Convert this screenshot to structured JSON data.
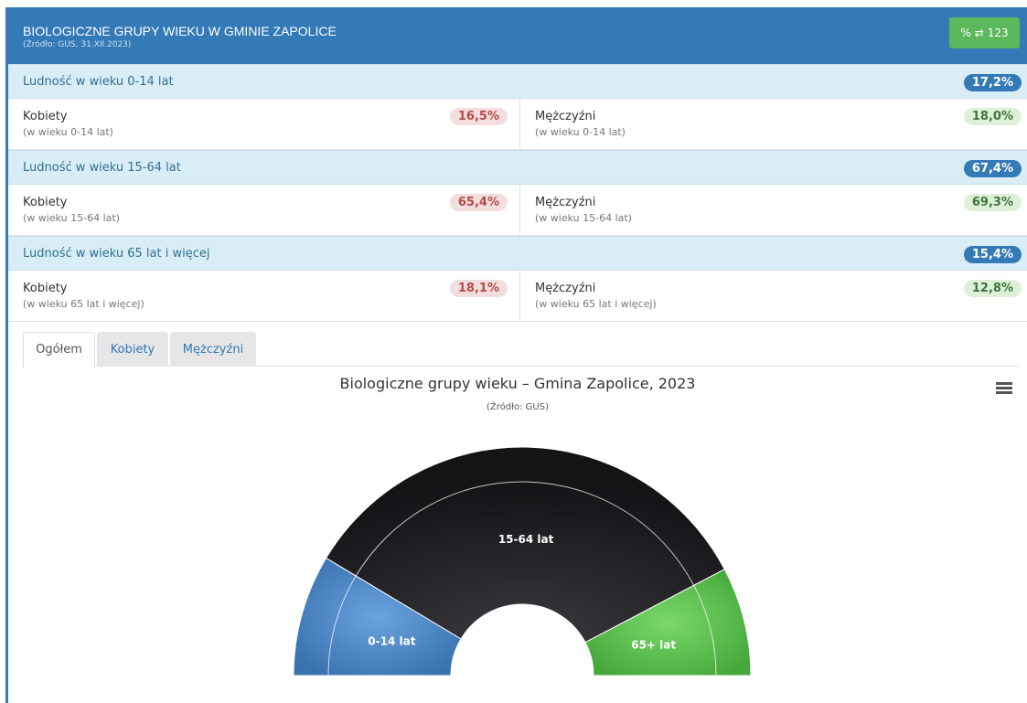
{
  "header": {
    "title": "BIOLOGICZNE GRUPY WIEKU W GMINIE ZAPOLICE",
    "subtitle": "(Źródło: GUS, 31.XII.2023)",
    "toggle_percent": "%",
    "toggle_value": "123"
  },
  "groups": [
    {
      "label": "Ludność w wieku 0-14 lat",
      "total": "17,2%",
      "women_label": "Kobiety",
      "women_note": "(w wieku 0-14 lat)",
      "women_value": "16,5%",
      "men_label": "Mężczyźni",
      "men_note": "(w wieku 0-14 lat)",
      "men_value": "18,0%"
    },
    {
      "label": "Ludność w wieku 15-64 lat",
      "total": "67,4%",
      "women_label": "Kobiety",
      "women_note": "(w wieku 15-64 lat)",
      "women_value": "65,4%",
      "men_label": "Mężczyźni",
      "men_note": "(w wieku 15-64 lat)",
      "men_value": "69,3%"
    },
    {
      "label": "Ludność w wieku 65 lat i więcej",
      "total": "15,4%",
      "women_label": "Kobiety",
      "women_note": "(w wieku 65 lat i więcej)",
      "women_value": "18,1%",
      "men_label": "Mężczyźni",
      "men_note": "(w wieku 65 lat i więcej)",
      "men_value": "12,8%"
    }
  ],
  "tabs": [
    {
      "label": "Ogółem",
      "active": true
    },
    {
      "label": "Kobiety",
      "active": false
    },
    {
      "label": "Mężczyźni",
      "active": false
    }
  ],
  "chart_data": {
    "type": "pie",
    "variant": "semi-donut",
    "title": "Biologiczne grupy wieku – Gmina Zapolice, 2023",
    "subtitle": "(Źródło: GUS)",
    "categories": [
      "0-14 lat",
      "15-64 lat",
      "65+ lat"
    ],
    "values": [
      17.2,
      67.4,
      15.4
    ],
    "colors": [
      "#4a86c8",
      "#1f1f23",
      "#5cc34f"
    ],
    "start_angle_deg": -90,
    "end_angle_deg": 90
  },
  "icons": {
    "menu": "hamburger-menu-icon",
    "swap": "swap-arrows-icon"
  }
}
